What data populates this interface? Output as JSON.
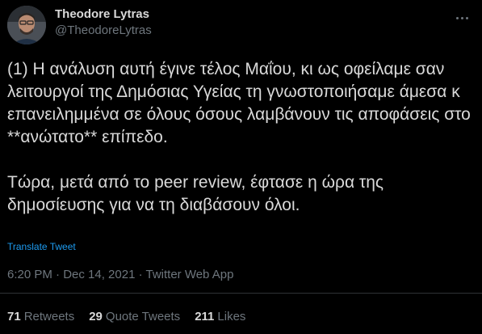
{
  "author": {
    "name": "Theodore Lytras",
    "handle": "@TheodoreLytras"
  },
  "tweet": {
    "text": "(1) Η ανάλυση αυτή έγινε τέλος Μαΐου, κι ως οφείλαμε σαν λειτουργοί της Δημόσιας Υγείας τη γνωστοποιήσαμε άμεσα κ επανειλημμένα σε όλους όσους λαμβάνουν τις αποφάσεις στο **ανώτατο** επίπεδο.\n\nΤώρα, μετά από το peer review, έφτασε η ώρα της δημοσίευσης για να τη διαβάσουν όλοι.",
    "translate_label": "Translate Tweet",
    "timestamp": "6:20 PM · Dec 14, 2021 · Twitter Web App"
  },
  "stats": {
    "retweets_count": "71",
    "retweets_label": "Retweets",
    "quotes_count": "29",
    "quotes_label": "Quote Tweets",
    "likes_count": "211",
    "likes_label": "Likes"
  },
  "icons": {
    "more": "more-icon"
  },
  "colors": {
    "background": "#000000",
    "text": "#d9d9d9",
    "secondary": "#6e767d",
    "link": "#1d9bf0",
    "divider": "#2f3336"
  }
}
